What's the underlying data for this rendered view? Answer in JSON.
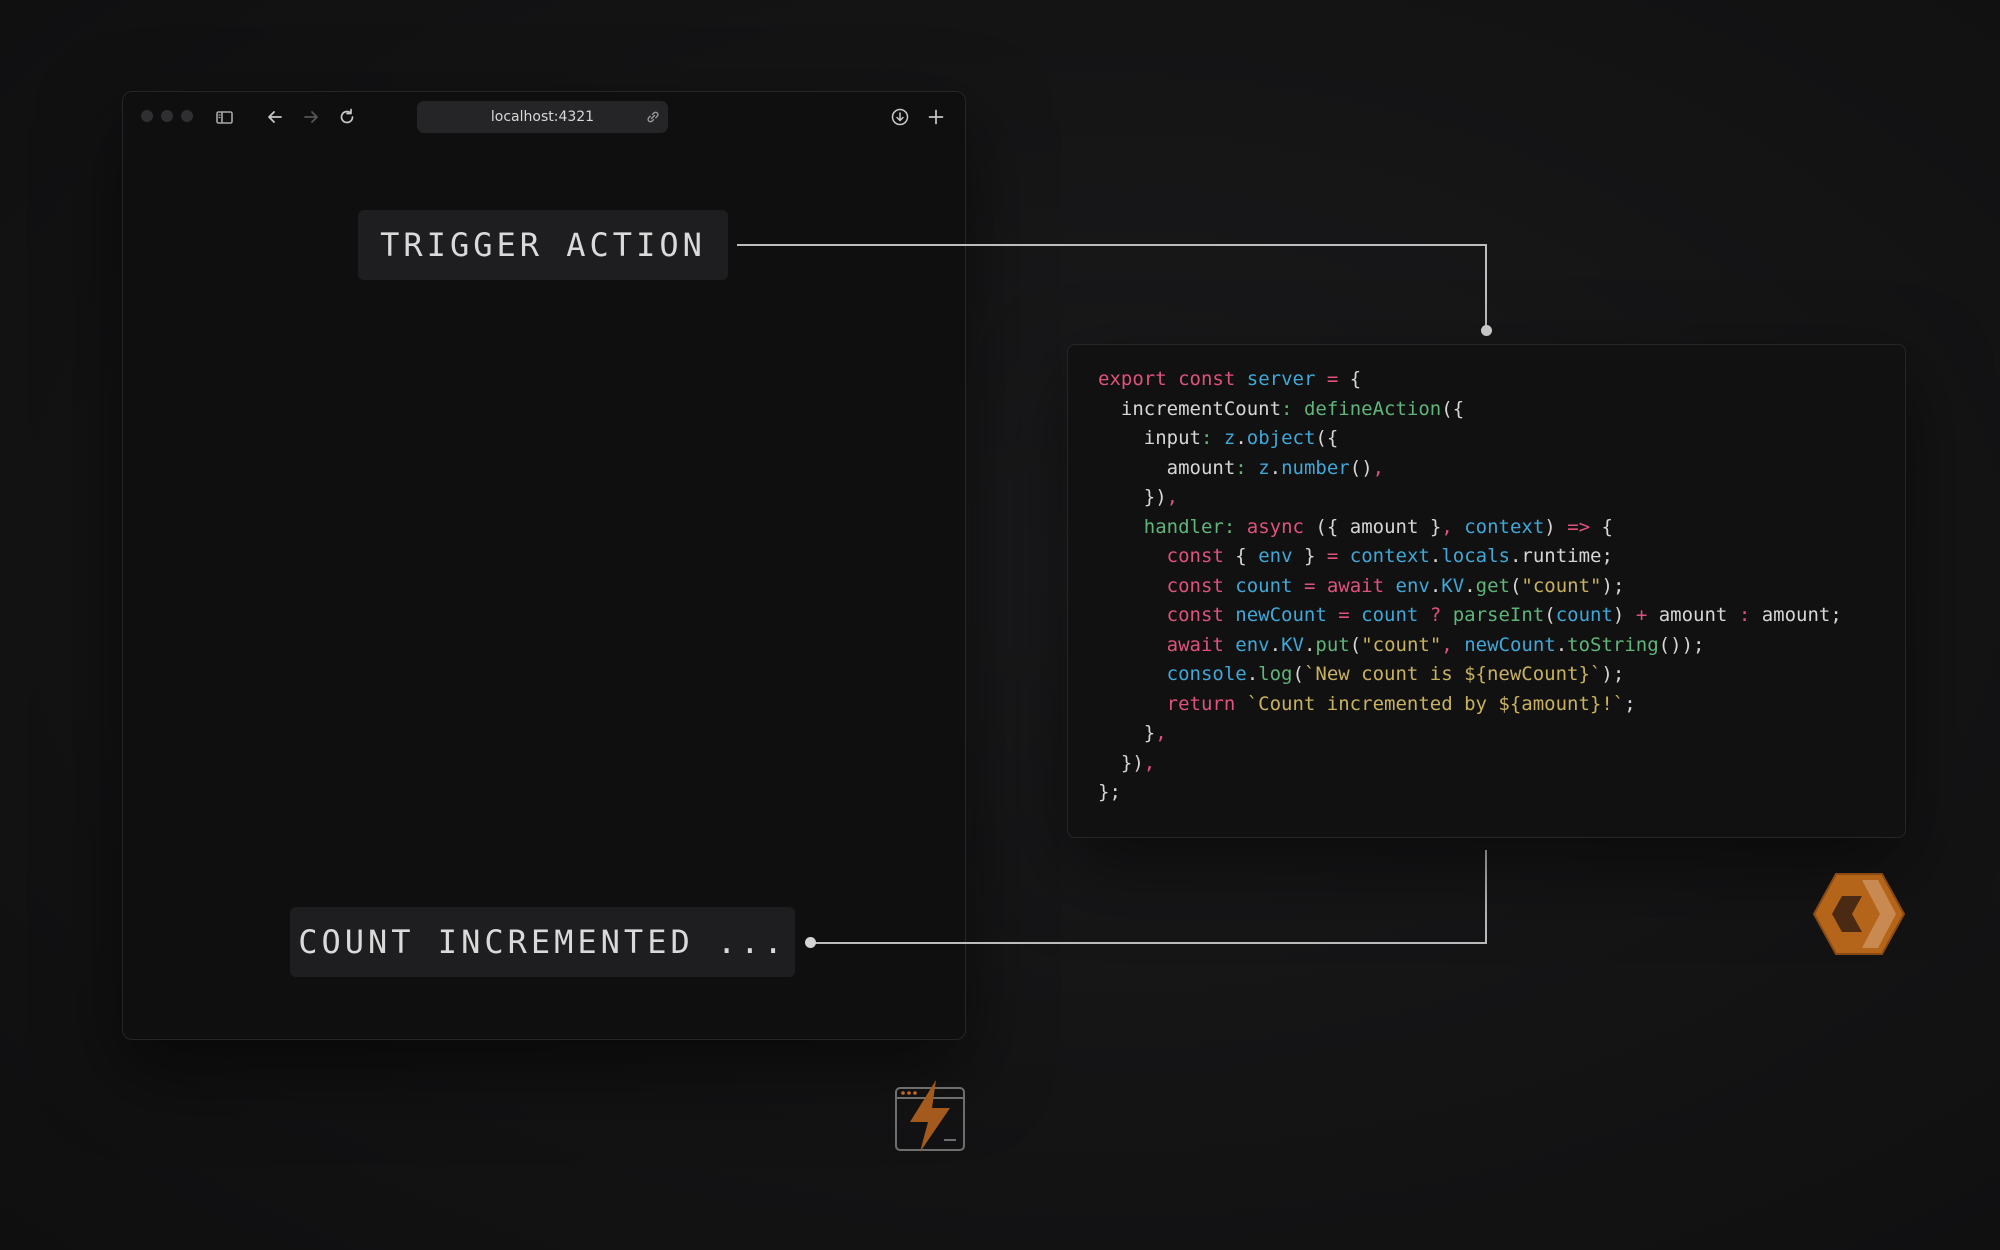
{
  "browser": {
    "url": "localhost:4321"
  },
  "trigger_button": {
    "label": "TRIGGER ACTION"
  },
  "result_label": {
    "text": "COUNT INCREMENTED ..."
  },
  "code": {
    "lines": [
      "export const server = {",
      "  incrementCount: defineAction({",
      "    input: z.object({",
      "      amount: z.number(),",
      "    }),",
      "    handler: async ({ amount }, context) => {",
      "      const { env } = context.locals.runtime;",
      "      const count = await env.KV.get(\"count\");",
      "      const newCount = count ? parseInt(count) + amount : amount;",
      "      await env.KV.put(\"count\", newCount.toString());",
      "      console.log(`New count is ${newCount}`);",
      "      return `Count incremented by ${amount}!`;",
      "    },",
      "  }),",
      "};"
    ]
  },
  "colors": {
    "keyword": "#e0527c",
    "identifier": "#3fa8d8",
    "function": "#5fb57a",
    "string": "#c9b25e",
    "default": "#d6d6d6",
    "accent": "#f48120"
  },
  "icons": [
    "sidebar-toggle-icon",
    "back-arrow-icon",
    "forward-arrow-icon",
    "reload-icon",
    "link-icon",
    "download-icon",
    "plus-icon",
    "astro-actions-logo",
    "cloudflare-logo"
  ]
}
